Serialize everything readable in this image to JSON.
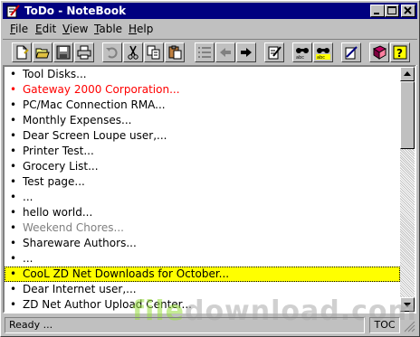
{
  "window": {
    "title": "ToDo - NoteBook"
  },
  "menu": [
    {
      "label": "File",
      "mnemonic": "F",
      "rest": "ile"
    },
    {
      "label": "Edit",
      "mnemonic": "E",
      "rest": "dit"
    },
    {
      "label": "View",
      "mnemonic": "V",
      "rest": "iew"
    },
    {
      "label": "Table",
      "mnemonic": "T",
      "rest": "able"
    },
    {
      "label": "Help",
      "mnemonic": "H",
      "rest": "elp"
    }
  ],
  "toolbar": {
    "buttons": [
      "new-note",
      "open",
      "save",
      "print",
      "undo",
      "cut",
      "copy",
      "paste",
      "list",
      "back",
      "forward",
      "edit-note",
      "find",
      "find-next",
      "notebook",
      "book",
      "help"
    ]
  },
  "list": {
    "bullet": "•",
    "items": [
      {
        "text": "Tool Disks...",
        "style": "normal"
      },
      {
        "text": "Gateway 2000 Corporation...",
        "style": "red"
      },
      {
        "text": "PC/Mac Connection RMA...",
        "style": "normal"
      },
      {
        "text": "Monthly Expenses...",
        "style": "normal"
      },
      {
        "text": "Dear Screen Loupe user,...",
        "style": "normal"
      },
      {
        "text": "Printer Test...",
        "style": "normal"
      },
      {
        "text": "Grocery List...",
        "style": "normal"
      },
      {
        "text": "Test page...",
        "style": "normal"
      },
      {
        "text": "...",
        "style": "normal"
      },
      {
        "text": "hello world...",
        "style": "normal"
      },
      {
        "text": "Weekend Chores...",
        "style": "gray"
      },
      {
        "text": "Shareware Authors...",
        "style": "normal"
      },
      {
        "text": "...",
        "style": "normal"
      },
      {
        "text": "CooL ZD Net Downloads for October...",
        "style": "highlight"
      },
      {
        "text": "Dear Internet user,...",
        "style": "normal"
      },
      {
        "text": "ZD Net Author Upload Center...",
        "style": "normal"
      }
    ]
  },
  "status": {
    "text": "Ready ...",
    "mode": "TOC"
  },
  "watermark": {
    "part1": "file",
    "part2": "download.com"
  },
  "colors": {
    "titlebar": "#000080",
    "red_item": "#ff0000",
    "gray_item": "#808080",
    "highlight": "#ffff00"
  }
}
